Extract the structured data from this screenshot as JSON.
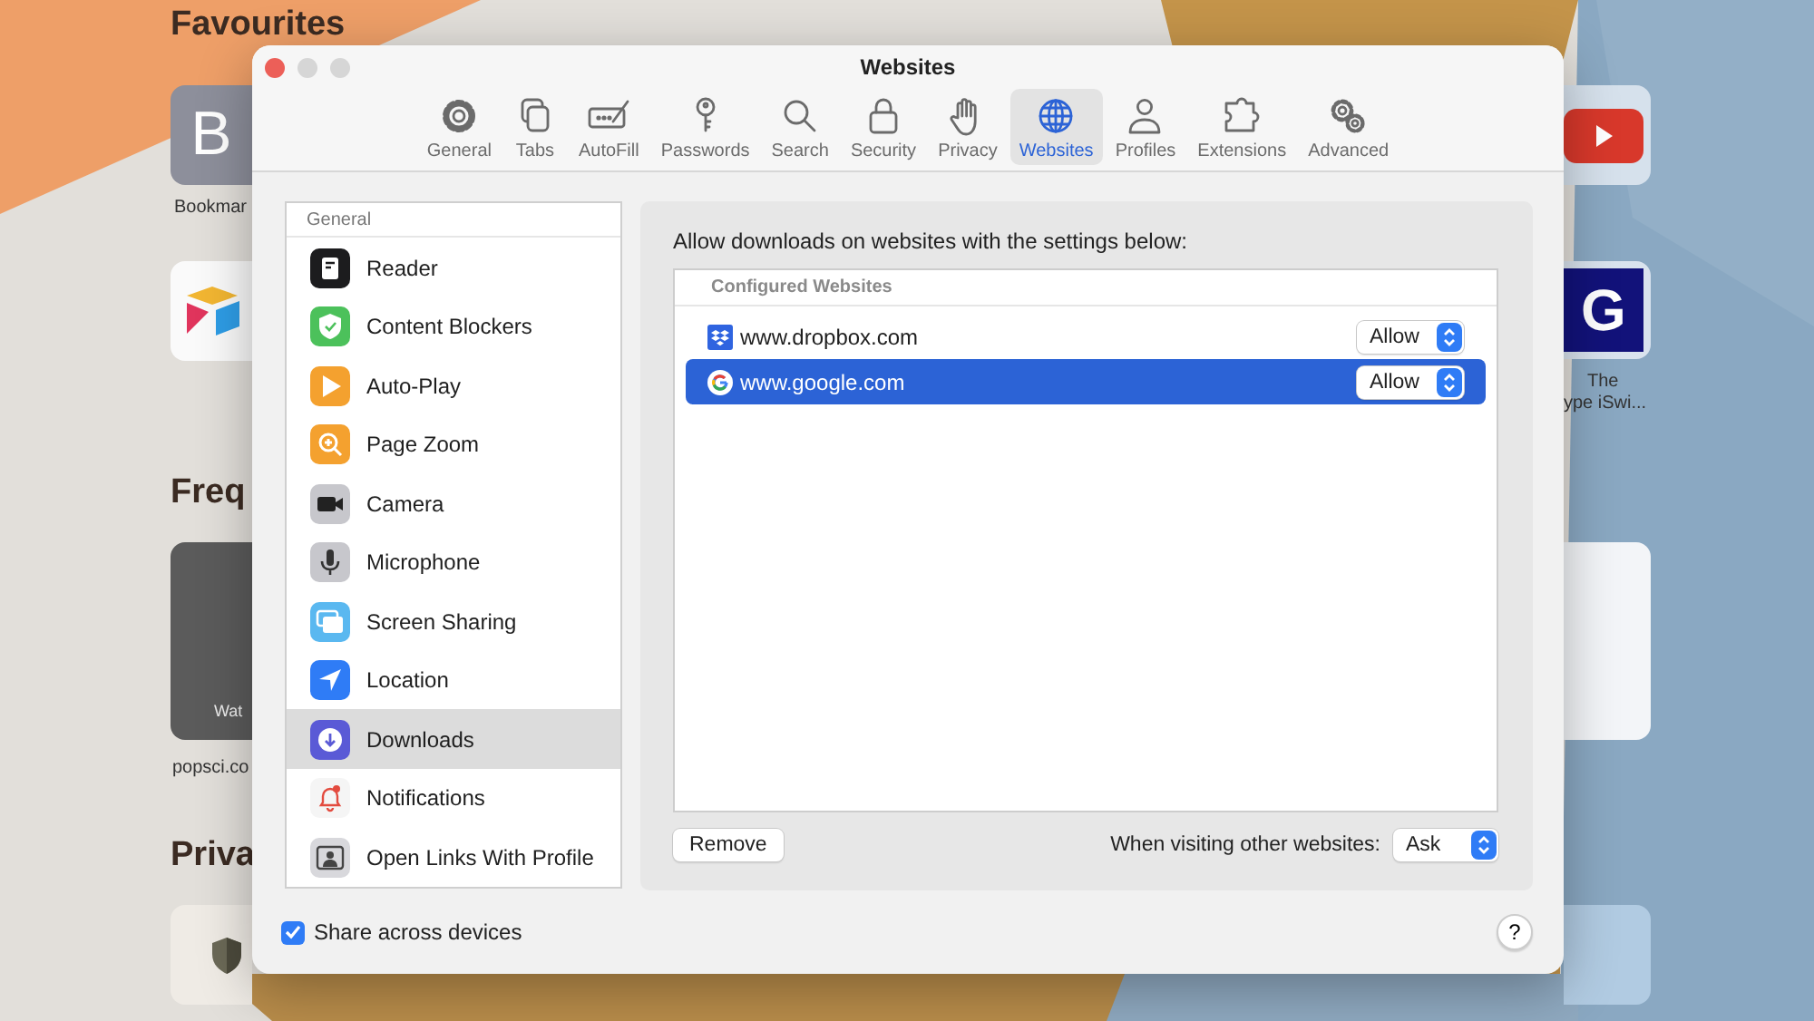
{
  "background": {
    "favourites_heading": "Favourites",
    "bookmark_tile_letter": "B",
    "bookmark_label": "Bookmar",
    "frequent_heading": "Freq",
    "thumbnail_text": "Wat",
    "popsci_label": "popsci.co",
    "privacy_heading": "Priva",
    "g_tile_letter": "G",
    "right_label_lines": [
      "The",
      "ype iSwi..."
    ]
  },
  "window": {
    "title": "Websites"
  },
  "toolbar": [
    {
      "label": "General",
      "kind": "gear",
      "selected": false
    },
    {
      "label": "Tabs",
      "kind": "tabs",
      "selected": false
    },
    {
      "label": "AutoFill",
      "kind": "autofill",
      "selected": false
    },
    {
      "label": "Passwords",
      "kind": "key",
      "selected": false
    },
    {
      "label": "Search",
      "kind": "search",
      "selected": false
    },
    {
      "label": "Security",
      "kind": "lock",
      "selected": false
    },
    {
      "label": "Privacy",
      "kind": "hand",
      "selected": false
    },
    {
      "label": "Websites",
      "kind": "globe",
      "selected": true
    },
    {
      "label": "Profiles",
      "kind": "person",
      "selected": false
    },
    {
      "label": "Extensions",
      "kind": "puzzle",
      "selected": false
    },
    {
      "label": "Advanced",
      "kind": "gears",
      "selected": false
    }
  ],
  "sidebar": {
    "header": "General",
    "items": [
      {
        "label": "Reader",
        "kind": "reader",
        "selected": false
      },
      {
        "label": "Content Blockers",
        "kind": "blockers",
        "selected": false
      },
      {
        "label": "Auto-Play",
        "kind": "autoplay",
        "selected": false
      },
      {
        "label": "Page Zoom",
        "kind": "zoom",
        "selected": false
      },
      {
        "label": "Camera",
        "kind": "camera",
        "selected": false
      },
      {
        "label": "Microphone",
        "kind": "microphone",
        "selected": false
      },
      {
        "label": "Screen Sharing",
        "kind": "screen",
        "selected": false
      },
      {
        "label": "Location",
        "kind": "location",
        "selected": false
      },
      {
        "label": "Downloads",
        "kind": "downloads",
        "selected": true
      },
      {
        "label": "Notifications",
        "kind": "notifications",
        "selected": false
      },
      {
        "label": "Open Links With Profile",
        "kind": "profile",
        "selected": false
      }
    ]
  },
  "panel": {
    "description": "Allow downloads on websites with the settings below:",
    "table_header": "Configured Websites",
    "rows": [
      {
        "site": "www.dropbox.com",
        "kind": "dropbox",
        "value": "Allow",
        "selected": false
      },
      {
        "site": "www.google.com",
        "kind": "google",
        "value": "Allow",
        "selected": true
      }
    ],
    "remove_button": "Remove",
    "other_label": "When visiting other websites:",
    "other_value": "Ask"
  },
  "share": {
    "label": "Share across devices",
    "checked": true
  },
  "help_button": "?"
}
